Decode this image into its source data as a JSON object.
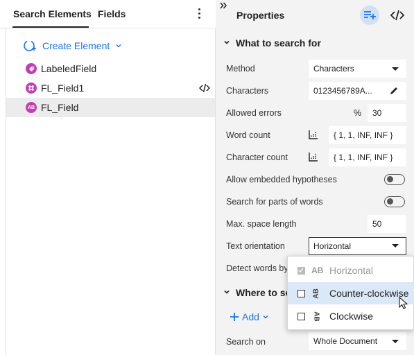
{
  "left": {
    "tabs": [
      "Search Elements",
      "Fields"
    ],
    "create_label": "Create Element",
    "items": [
      {
        "label": "LabeledField",
        "icon": "tag-icon"
      },
      {
        "label": "FL_Field1",
        "icon": "fields-icon"
      },
      {
        "label": "FL_Field",
        "icon_text": "AB"
      }
    ]
  },
  "right": {
    "title": "Properties",
    "section1": "What to search for",
    "section2_partial": "Where to se",
    "props": {
      "method_label": "Method",
      "method_value": "Characters",
      "characters_label": "Characters",
      "characters_value": "0123456789A...",
      "allowed_errors_label": "Allowed errors",
      "allowed_errors_unit": "%",
      "allowed_errors_value": "30",
      "word_count_label": "Word count",
      "word_count_value": "{ 1, 1, INF, INF }",
      "char_count_label": "Character count",
      "char_count_value": "{ 1, 1, INF, INF }",
      "embedded_label": "Allow embedded hypotheses",
      "parts_label": "Search for parts of words",
      "max_space_label": "Max. space length",
      "max_space_value": "50",
      "orientation_label": "Text orientation",
      "orientation_value": "Horizontal",
      "detect_label": "Detect words by"
    },
    "add_label": "Add",
    "search_on_label": "Search on",
    "search_on_value": "Whole Document"
  },
  "popup": {
    "options": [
      {
        "label": "Horizontal",
        "icon_text": "AB"
      },
      {
        "label": "Counter-clockwise",
        "icon_text": "AB"
      },
      {
        "label": "Clockwise",
        "icon_text": "AB"
      }
    ]
  },
  "colors": {
    "accent": "#1a73e8",
    "element_icon": "#c13fb4",
    "panel_bg": "#f3f3f3"
  }
}
